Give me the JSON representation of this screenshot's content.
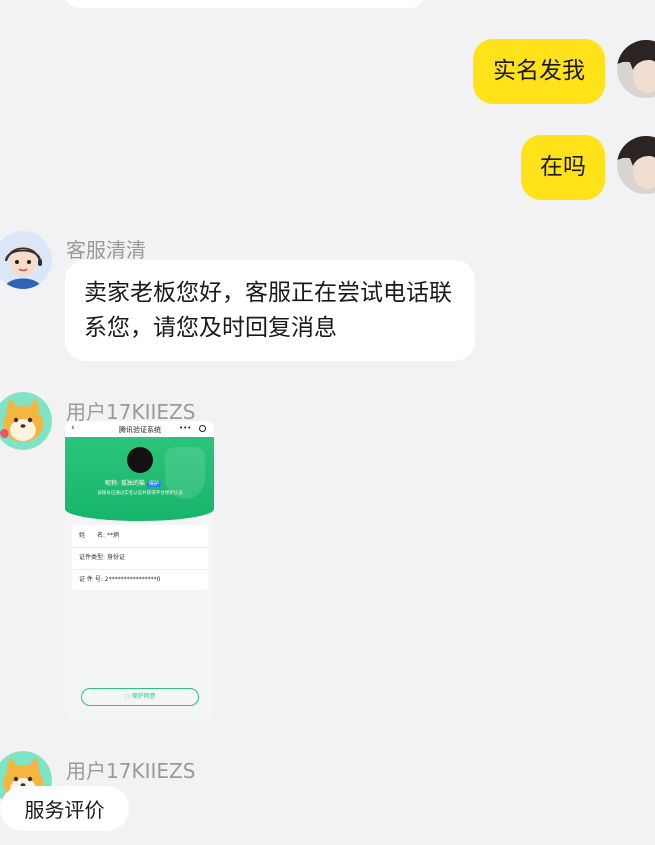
{
  "messages": {
    "outgoing_1": "实名发我",
    "outgoing_2": "在吗",
    "agent": {
      "name": "客服清清",
      "text": "卖家老板您好，客服正在尝试电话联系您，请您及时回复消息"
    },
    "user_1": {
      "name": "用户17KIIEZS"
    },
    "user_2": {
      "name": "用户17KIIEZS"
    }
  },
  "screenshot": {
    "title": "腾讯验证系统",
    "menu": "•••",
    "nickname": "昵称: 孤独的猫",
    "badge": "保护",
    "desc": "该账号已通过实名认证并获得平台保护认证",
    "rows": [
      {
        "label": "姓　　名:",
        "value": "**炳"
      },
      {
        "label": "证件类型:",
        "value": "身份证"
      },
      {
        "label": "证 件 号:",
        "value": "2****************0"
      }
    ],
    "button": "保护同意"
  },
  "footer": {
    "service_rating": "服务评价"
  },
  "colors": {
    "accent_yellow": "#ffe21a",
    "background": "#f2f2f4",
    "green": "#2bc47a"
  }
}
